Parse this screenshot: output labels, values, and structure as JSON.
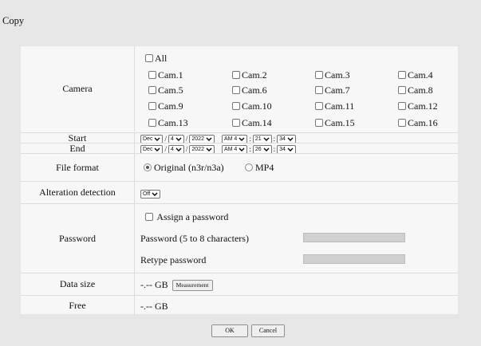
{
  "title": "Copy",
  "labels": {
    "camera": "Camera",
    "start": "Start",
    "end": "End",
    "file_format": "File format",
    "alteration_detection": "Alteration detection",
    "password": "Password",
    "data_size": "Data size",
    "free": "Free"
  },
  "camera": {
    "all_label": "All",
    "all_checked": false,
    "cameras": [
      "Cam.1",
      "Cam.2",
      "Cam.3",
      "Cam.4",
      "Cam.5",
      "Cam.6",
      "Cam.7",
      "Cam.8",
      "Cam.9",
      "Cam.10",
      "Cam.11",
      "Cam.12",
      "Cam.13",
      "Cam.14",
      "Cam.15",
      "Cam.16"
    ]
  },
  "start": {
    "month": "Dec",
    "day": "4",
    "year": "2022",
    "hour": "AM 4",
    "minute": "21",
    "second": "34",
    "sep_date": "/",
    "sep_time": ":"
  },
  "end": {
    "month": "Dec",
    "day": "4",
    "year": "2022",
    "hour": "AM 4",
    "minute": "26",
    "second": "34",
    "sep_date": "/",
    "sep_time": ":"
  },
  "file_format": {
    "options": [
      "Original (n3r/n3a)",
      "MP4"
    ],
    "selected": "Original (n3r/n3a)"
  },
  "alteration_detection": {
    "value": "Off"
  },
  "password": {
    "assign_label": "Assign a password",
    "password_label": "Password (5 to 8 characters)",
    "retype_label": "Retype password",
    "password_value": "",
    "retype_value": ""
  },
  "data_size": {
    "value": "-.-- GB",
    "measure_label": "Measurement"
  },
  "free": {
    "value": "-.-- GB"
  },
  "buttons": {
    "ok": "OK",
    "cancel": "Cancel"
  }
}
